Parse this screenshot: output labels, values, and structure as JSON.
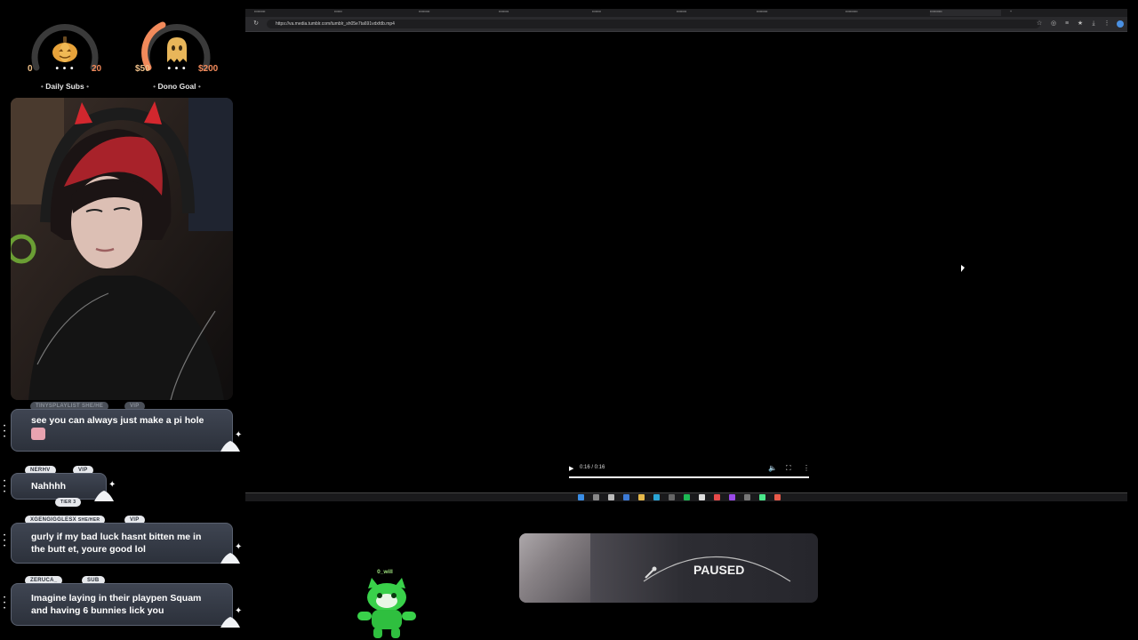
{
  "goals": [
    {
      "min": "0",
      "dots": "• • •",
      "max": "20",
      "label": "Daily Subs",
      "icon": "pumpkin-icon"
    },
    {
      "min": "$50",
      "dots": "• • •",
      "max": "$200",
      "label": "Dono Goal",
      "icon": "ghost-icon"
    }
  ],
  "chat": [
    {
      "user": "TINYSPLAYLIST",
      "pronoun": "SHE/HE",
      "badges": [
        "VIP"
      ],
      "message": "see you can always just make a pi hole"
    },
    {
      "user": "NERHV",
      "pronoun": "",
      "badges": [
        "VIP",
        "TIER 3"
      ],
      "message": "Nahhhh"
    },
    {
      "user": "XGENGIGGLESX",
      "pronoun": "SHE/HER",
      "badges": [
        "VIP"
      ],
      "message": "gurly if my bad luck hasnt bitten me in the butt et, youre good lol"
    },
    {
      "user": "ZERUCA_",
      "pronoun": "",
      "badges": [
        "SUB"
      ],
      "message": "Imagine laying in their playpen Squam and having 6 bunnies lick you"
    }
  ],
  "browser": {
    "url": "https://va.media.tumblr.com/tumblr_sh05e7ta691vdxfdb.mp4",
    "video_time": "0:16 / 0:16",
    "progress": 1.0
  },
  "paused_label": "PAUSED",
  "mascot_name": "0_will",
  "colors": {
    "accent_orange": "#f28a5b",
    "gauge_track": "#3a3a3a",
    "mascot_green": "#39d14a"
  }
}
